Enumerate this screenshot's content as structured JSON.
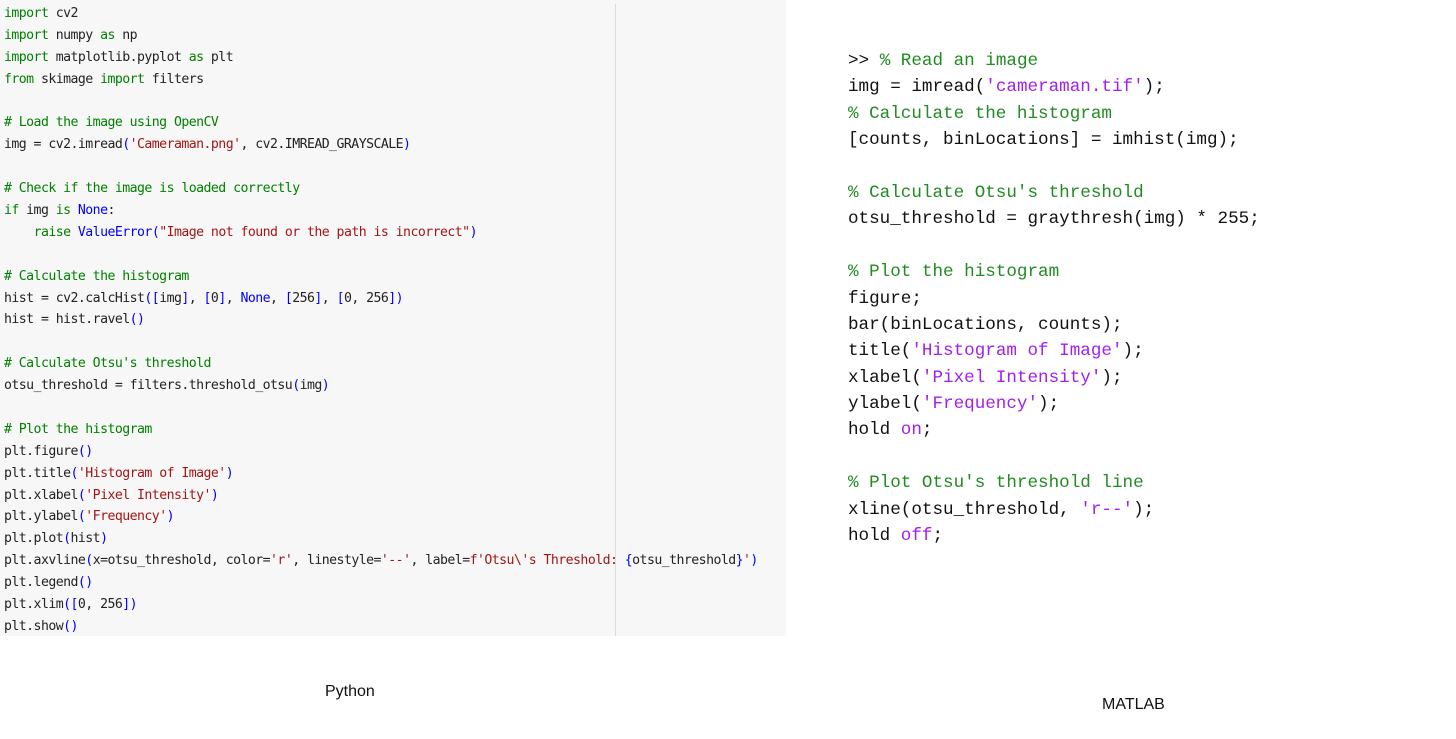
{
  "colors": {
    "python": {
      "keyword": "#008000",
      "comment": "#008000",
      "string": "#a31515",
      "builtin": "#0000ff",
      "paren": "#0000ff",
      "text": "#222222"
    },
    "matlab": {
      "comment": "#228b22",
      "string": "#a020f0",
      "keyword": "#a020f0",
      "text": "#111111"
    }
  },
  "python": {
    "caption": "Python",
    "lines": [
      [
        [
          "kw",
          "import"
        ],
        [
          "t",
          " cv2"
        ]
      ],
      [
        [
          "kw",
          "import"
        ],
        [
          "t",
          " numpy "
        ],
        [
          "kw",
          "as"
        ],
        [
          "t",
          " np"
        ]
      ],
      [
        [
          "kw",
          "import"
        ],
        [
          "t",
          " matplotlib.pyplot "
        ],
        [
          "kw",
          "as"
        ],
        [
          "t",
          " plt"
        ]
      ],
      [
        [
          "kw",
          "from"
        ],
        [
          "t",
          " skimage "
        ],
        [
          "kw",
          "import"
        ],
        [
          "t",
          " filters"
        ]
      ],
      [],
      [
        [
          "cm",
          "# Load the image using OpenCV"
        ]
      ],
      [
        [
          "t",
          "img = cv2.imread"
        ],
        [
          "p",
          "("
        ],
        [
          "st",
          "'Cameraman.png'"
        ],
        [
          "t",
          ", cv2.IMREAD_GRAYSCALE"
        ],
        [
          "p",
          ")"
        ]
      ],
      [],
      [
        [
          "cm",
          "# Check if the image is loaded correctly"
        ]
      ],
      [
        [
          "kw",
          "if"
        ],
        [
          "t",
          " img "
        ],
        [
          "kw",
          "is"
        ],
        [
          "t",
          " "
        ],
        [
          "bi",
          "None"
        ],
        [
          "t",
          ":"
        ]
      ],
      [
        [
          "t",
          "    "
        ],
        [
          "kw",
          "raise"
        ],
        [
          "t",
          " "
        ],
        [
          "bi",
          "ValueError"
        ],
        [
          "p",
          "("
        ],
        [
          "st",
          "\"Image not found or the path is incorrect\""
        ],
        [
          "p",
          ")"
        ]
      ],
      [],
      [
        [
          "cm",
          "# Calculate the histogram"
        ]
      ],
      [
        [
          "t",
          "hist = cv2.calcHist"
        ],
        [
          "p",
          "(["
        ],
        [
          "t",
          "img"
        ],
        [
          "p",
          "]"
        ],
        [
          "t",
          ", "
        ],
        [
          "p",
          "["
        ],
        [
          "t",
          "0"
        ],
        [
          "p",
          "]"
        ],
        [
          "t",
          ", "
        ],
        [
          "bi",
          "None"
        ],
        [
          "t",
          ", "
        ],
        [
          "p",
          "["
        ],
        [
          "t",
          "256"
        ],
        [
          "p",
          "]"
        ],
        [
          "t",
          ", "
        ],
        [
          "p",
          "["
        ],
        [
          "t",
          "0, 256"
        ],
        [
          "p",
          "])"
        ]
      ],
      [
        [
          "t",
          "hist = hist.ravel"
        ],
        [
          "p",
          "()"
        ]
      ],
      [],
      [
        [
          "cm",
          "# Calculate Otsu's threshold"
        ]
      ],
      [
        [
          "t",
          "otsu_threshold = filters.threshold_otsu"
        ],
        [
          "p",
          "("
        ],
        [
          "t",
          "img"
        ],
        [
          "p",
          ")"
        ]
      ],
      [],
      [
        [
          "cm",
          "# Plot the histogram"
        ]
      ],
      [
        [
          "t",
          "plt.figure"
        ],
        [
          "p",
          "()"
        ]
      ],
      [
        [
          "t",
          "plt.title"
        ],
        [
          "p",
          "("
        ],
        [
          "st",
          "'Histogram of Image'"
        ],
        [
          "p",
          ")"
        ]
      ],
      [
        [
          "t",
          "plt.xlabel"
        ],
        [
          "p",
          "("
        ],
        [
          "st",
          "'Pixel Intensity'"
        ],
        [
          "p",
          ")"
        ]
      ],
      [
        [
          "t",
          "plt.ylabel"
        ],
        [
          "p",
          "("
        ],
        [
          "st",
          "'Frequency'"
        ],
        [
          "p",
          ")"
        ]
      ],
      [
        [
          "t",
          "plt.plot"
        ],
        [
          "p",
          "("
        ],
        [
          "t",
          "hist"
        ],
        [
          "p",
          ")"
        ]
      ],
      [
        [
          "t",
          "plt.axvline"
        ],
        [
          "p",
          "("
        ],
        [
          "t",
          "x=otsu_threshold, color="
        ],
        [
          "st",
          "'r'"
        ],
        [
          "t",
          ", linestyle="
        ],
        [
          "st",
          "'--'"
        ],
        [
          "t",
          ", label="
        ],
        [
          "st",
          "f'Otsu\\'s Threshold: "
        ],
        [
          "p",
          "{"
        ],
        [
          "t",
          "otsu_threshold"
        ],
        [
          "p",
          "}"
        ],
        [
          "st",
          "'"
        ],
        [
          "p",
          ")"
        ]
      ],
      [
        [
          "t",
          "plt.legend"
        ],
        [
          "p",
          "()"
        ]
      ],
      [
        [
          "t",
          "plt.xlim"
        ],
        [
          "p",
          "(["
        ],
        [
          "t",
          "0, 256"
        ],
        [
          "p",
          "])"
        ]
      ],
      [
        [
          "t",
          "plt.show"
        ],
        [
          "p",
          "()"
        ]
      ]
    ]
  },
  "matlab": {
    "caption": "MATLAB",
    "lines": [
      [
        [
          "t",
          ">> "
        ],
        [
          "cm",
          "% Read an image"
        ]
      ],
      [
        [
          "t",
          "img = imread("
        ],
        [
          "st",
          "'cameraman.tif'"
        ],
        [
          "t",
          ");"
        ]
      ],
      [
        [
          "cm",
          "% Calculate the histogram"
        ]
      ],
      [
        [
          "t",
          "[counts, binLocations] = imhist(img);"
        ]
      ],
      [],
      [
        [
          "cm",
          "% Calculate Otsu's threshold"
        ]
      ],
      [
        [
          "t",
          "otsu_threshold = graythresh(img) * 255;"
        ]
      ],
      [],
      [
        [
          "cm",
          "% Plot the histogram"
        ]
      ],
      [
        [
          "t",
          "figure;"
        ]
      ],
      [
        [
          "t",
          "bar(binLocations, counts);"
        ]
      ],
      [
        [
          "t",
          "title("
        ],
        [
          "st",
          "'Histogram of Image'"
        ],
        [
          "t",
          ");"
        ]
      ],
      [
        [
          "t",
          "xlabel("
        ],
        [
          "st",
          "'Pixel Intensity'"
        ],
        [
          "t",
          ");"
        ]
      ],
      [
        [
          "t",
          "ylabel("
        ],
        [
          "st",
          "'Frequency'"
        ],
        [
          "t",
          ");"
        ]
      ],
      [
        [
          "t",
          "hold "
        ],
        [
          "kw",
          "on"
        ],
        [
          "t",
          ";"
        ]
      ],
      [],
      [
        [
          "cm",
          "% Plot Otsu's threshold line"
        ]
      ],
      [
        [
          "t",
          "xline(otsu_threshold, "
        ],
        [
          "st",
          "'r--'"
        ],
        [
          "t",
          ");"
        ]
      ],
      [
        [
          "t",
          "hold "
        ],
        [
          "kw",
          "off"
        ],
        [
          "t",
          ";"
        ]
      ]
    ]
  }
}
